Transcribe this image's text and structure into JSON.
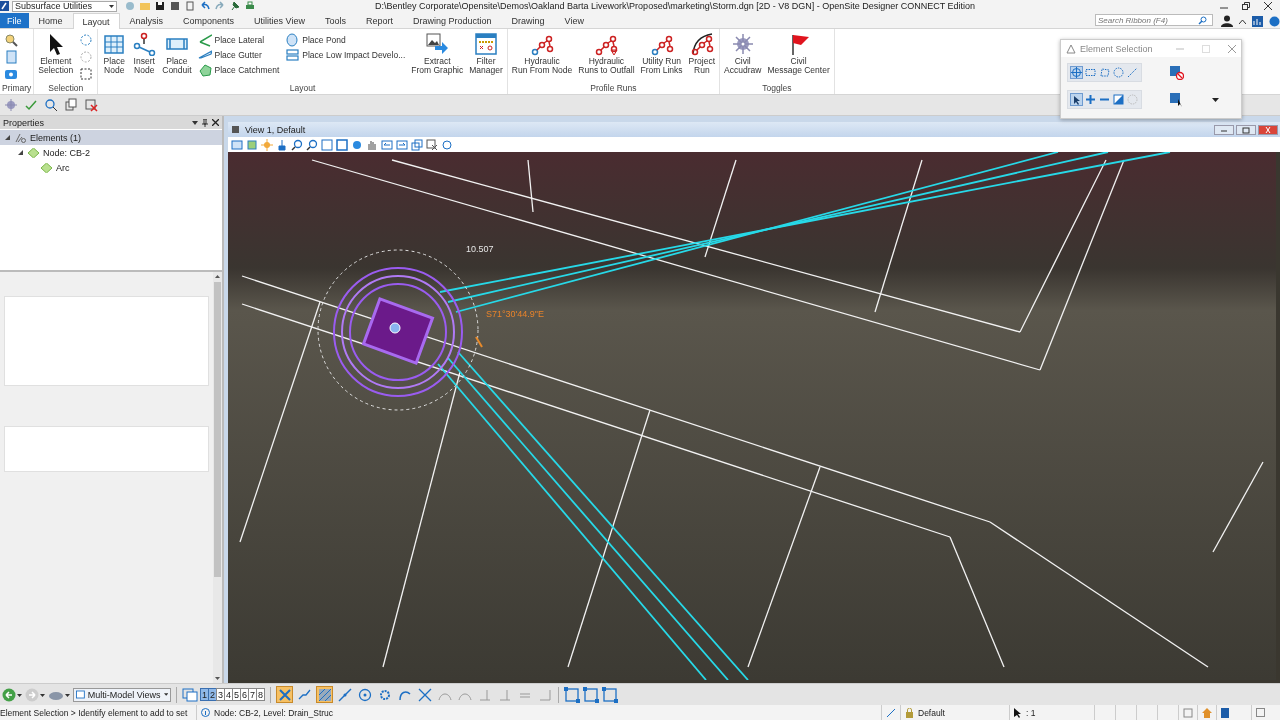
{
  "title_bar": {
    "workspace": "Subsurface Utilities",
    "title": "D:\\Bentley Corporate\\Opensite\\Demos\\Oakland Barta Livework\\Proposed\\marketing\\Storm.dgn [2D - V8 DGN] - OpenSite Designer CONNECT Edition"
  },
  "ribbon": {
    "tabs": [
      {
        "label": "File",
        "kind": "backstage",
        "selected": false
      },
      {
        "label": "Home",
        "kind": "tab",
        "selected": false
      },
      {
        "label": "Layout",
        "kind": "tab",
        "selected": true
      },
      {
        "label": "Analysis",
        "kind": "tab",
        "selected": false
      },
      {
        "label": "Components",
        "kind": "tab",
        "selected": false
      },
      {
        "label": "Utilities View",
        "kind": "tab",
        "selected": false
      },
      {
        "label": "Tools",
        "kind": "tab",
        "selected": false
      },
      {
        "label": "Report",
        "kind": "tab",
        "selected": false
      },
      {
        "label": "Drawing Production",
        "kind": "tab",
        "selected": false
      },
      {
        "label": "Drawing",
        "kind": "tab",
        "selected": false
      },
      {
        "label": "View",
        "kind": "tab",
        "selected": false
      }
    ],
    "search": {
      "placeholder": "Search Ribbon (F4)"
    },
    "groups": [
      {
        "label": "Primary",
        "items": [
          {
            "kind": "icons"
          }
        ]
      },
      {
        "label": "Selection",
        "items": [
          {
            "kind": "large",
            "label": "Element\nSelection"
          },
          {
            "kind": "icons"
          }
        ]
      },
      {
        "label": "Layout",
        "items": [
          {
            "kind": "large",
            "label": "Place\nNode"
          },
          {
            "kind": "large",
            "label": "Insert\nNode"
          },
          {
            "kind": "large",
            "label": "Place\nConduit"
          },
          {
            "kind": "stack",
            "buttons": [
              {
                "label": "Place Lateral"
              },
              {
                "label": "Place Gutter"
              },
              {
                "label": "Place Catchment"
              }
            ]
          },
          {
            "kind": "stack",
            "buttons": [
              {
                "label": "Place Pond"
              },
              {
                "label": "Place Low Impact Develo..."
              }
            ]
          },
          {
            "kind": "large",
            "label": "Extract\nFrom Graphic"
          },
          {
            "kind": "large",
            "label": "Filter\nManager"
          }
        ]
      },
      {
        "label": "Profile Runs",
        "items": [
          {
            "kind": "large",
            "label": "Hydraulic\nRun From Node"
          },
          {
            "kind": "large",
            "label": "Hydraulic\nRuns to Outfall"
          },
          {
            "kind": "large",
            "label": "Utility Run\nFrom Links"
          },
          {
            "kind": "large",
            "label": "Project\nRun"
          }
        ]
      },
      {
        "label": "Toggles",
        "items": [
          {
            "kind": "large",
            "label": "Civil\nAccudraw"
          },
          {
            "kind": "large",
            "label": "Civil\nMessage Center"
          }
        ]
      }
    ]
  },
  "properties": {
    "title": "Properties",
    "tree": [
      {
        "label": "Elements (1)",
        "selected": true,
        "expanded": true,
        "children": [
          {
            "label": "Node: CB-2",
            "selected": false,
            "expanded": true,
            "children": [
              {
                "label": "Arc",
                "selected": false
              }
            ]
          }
        ]
      }
    ]
  },
  "view": {
    "title": "View 1, Default",
    "canvas": {
      "dimension": "10.507",
      "bearing": "S71°30'44.9\"E"
    }
  },
  "element_selection": {
    "title": "Element Selection",
    "methods": [
      {
        "selected": true
      },
      {
        "selected": false
      },
      {
        "selected": false
      },
      {
        "selected": false
      },
      {
        "selected": false
      }
    ],
    "modes": [
      {
        "selected": true
      },
      {
        "selected": false
      },
      {
        "selected": false
      },
      {
        "selected": false
      },
      {
        "selected": false
      }
    ]
  },
  "bottom_toolbar": {
    "model_dropdown": "Multi-Model Views",
    "views": [
      {
        "label": "1",
        "selected": true
      },
      {
        "label": "2",
        "selected": true
      },
      {
        "label": "3",
        "selected": false
      },
      {
        "label": "4",
        "selected": false
      },
      {
        "label": "5",
        "selected": false
      },
      {
        "label": "6",
        "selected": false
      },
      {
        "label": "7",
        "selected": false
      },
      {
        "label": "8",
        "selected": false
      }
    ],
    "snaps": [
      {
        "selected": true
      },
      {
        "selected": false
      },
      {
        "selected": true
      },
      {
        "selected": false
      },
      {
        "selected": false
      },
      {
        "selected": false
      },
      {
        "selected": false
      },
      {
        "selected": false
      },
      {
        "selected": false
      },
      {
        "selected": false
      },
      {
        "selected": false
      },
      {
        "selected": false
      },
      {
        "selected": false
      },
      {
        "selected": false
      }
    ]
  },
  "status_bar": {
    "prompt": "Element Selection > Identify element to add to set",
    "info": "Node: CB-2, Level: Drain_Struc",
    "active_level_name": "Default",
    "selection_count": ": 1"
  }
}
